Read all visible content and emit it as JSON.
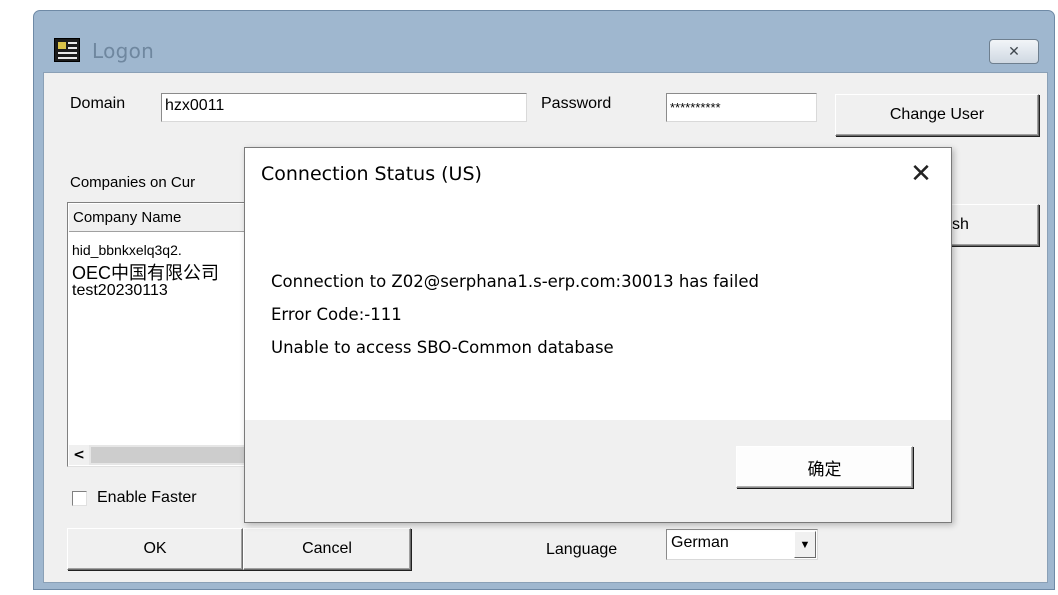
{
  "logon": {
    "title": "Logon",
    "close_icon": "close-x-icon",
    "domain_label": "Domain",
    "domain_value": "hzx0011",
    "password_label": "Password",
    "password_value": "**********",
    "change_user_label": "Change User",
    "companies_label": "Companies on Cur",
    "company_name_header": "Company Name",
    "companies": [
      "hid_bbnkxelq3q2.",
      "OEC中国有限公司",
      "test20230113"
    ],
    "refresh_label": "sh",
    "scroll_left_icon": "chevron-left-icon",
    "enable_faster_label": "Enable Faster",
    "ok_label": "OK",
    "cancel_label": "Cancel",
    "language_label": "Language",
    "language_value": "German",
    "dropdown_icon": "chevron-down-icon"
  },
  "dialog": {
    "title": "Connection Status (US)",
    "close_icon": "close-x-icon",
    "messages": [
      "Connection to Z02@serphana1.s-erp.com:30013 has failed",
      "Error Code:-111",
      "Unable to access SBO-Common database"
    ],
    "confirm_label": "确定"
  }
}
